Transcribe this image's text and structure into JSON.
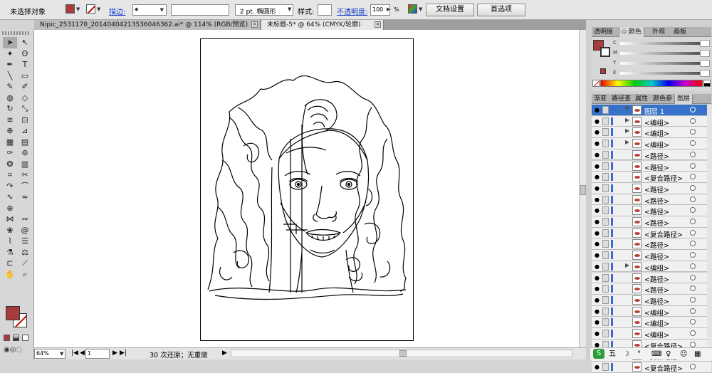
{
  "control_bar": {
    "selection_label": "未选择对象",
    "fill_color": "#a83b3b",
    "stroke_label": "描边:",
    "stroke_size": "",
    "brush_value": "",
    "brush_label": "2 pt. 椭圆形",
    "style_label": "样式:",
    "opacity_label": "不透明度:",
    "opacity_value": "100",
    "percent": "%",
    "doc_setup": "文档设置",
    "preferences": "首选项"
  },
  "tabs": [
    {
      "label": "Nipic_2531170_20140404213536046362.ai* @ 114% (RGB/预览)",
      "active": false
    },
    {
      "label": "未标题-5* @ 64% (CMYK/轮廓)",
      "active": true
    }
  ],
  "tools": [
    {
      "icon": "selection-tool-icon",
      "glyph": "➤"
    },
    {
      "icon": "direct-selection-tool-icon",
      "glyph": "↖"
    },
    {
      "icon": "magic-wand-icon",
      "glyph": "✦"
    },
    {
      "icon": "lasso-icon",
      "glyph": "ʘ"
    },
    {
      "icon": "pen-tool-icon",
      "glyph": "✒"
    },
    {
      "icon": "type-tool-icon",
      "glyph": "T"
    },
    {
      "icon": "line-tool-icon",
      "glyph": "╲"
    },
    {
      "icon": "rectangle-tool-icon",
      "glyph": "▭"
    },
    {
      "icon": "paintbrush-icon",
      "glyph": "✎"
    },
    {
      "icon": "pencil-icon",
      "glyph": "✐"
    },
    {
      "icon": "blob-brush-icon",
      "glyph": "◍"
    },
    {
      "icon": "eraser-icon",
      "glyph": "◇"
    },
    {
      "icon": "rotate-tool-icon",
      "glyph": "↻"
    },
    {
      "icon": "scale-tool-icon",
      "glyph": "⤡"
    },
    {
      "icon": "warp-tool-icon",
      "glyph": "≋"
    },
    {
      "icon": "free-transform-icon",
      "glyph": "⊡"
    },
    {
      "icon": "shape-builder-icon",
      "glyph": "⊕"
    },
    {
      "icon": "perspective-grid-icon",
      "glyph": "⊿"
    },
    {
      "icon": "mesh-tool-icon",
      "glyph": "▦"
    },
    {
      "icon": "gradient-tool-icon",
      "glyph": "▤"
    },
    {
      "icon": "eyedropper-icon",
      "glyph": "✑"
    },
    {
      "icon": "blend-tool-icon",
      "glyph": "⊚"
    },
    {
      "icon": "symbol-sprayer-icon",
      "glyph": "❂"
    },
    {
      "icon": "column-graph-icon",
      "glyph": "▥"
    },
    {
      "icon": "artboard-tool-icon",
      "glyph": "⌗"
    },
    {
      "icon": "slice-tool-icon",
      "glyph": "✂"
    },
    {
      "icon": "curve-red-icon",
      "glyph": "↷"
    },
    {
      "icon": "arc-red-icon",
      "glyph": "⌒"
    },
    {
      "icon": "wave-blue-icon",
      "glyph": "∿"
    },
    {
      "icon": "zigzag-icon",
      "glyph": "≈"
    },
    {
      "icon": "target-icon",
      "glyph": "⊕"
    },
    {
      "icon": "blank-icon",
      "glyph": ""
    },
    {
      "icon": "width-tool-icon",
      "glyph": "⋈"
    },
    {
      "icon": "wave-tool-icon",
      "glyph": "∾"
    },
    {
      "icon": "scallop-icon",
      "glyph": "❀"
    },
    {
      "icon": "twirl-icon",
      "glyph": "@"
    },
    {
      "icon": "wrinkle-icon",
      "glyph": "⌇"
    },
    {
      "icon": "align-icon",
      "glyph": "☰"
    },
    {
      "icon": "eyedropper2-icon",
      "glyph": "⚗"
    },
    {
      "icon": "measure-icon",
      "glyph": "⚖"
    },
    {
      "icon": "crop-icon",
      "glyph": "⊏"
    },
    {
      "icon": "knife-icon",
      "glyph": "⟋"
    },
    {
      "icon": "hand-tool-icon",
      "glyph": "✋"
    },
    {
      "icon": "zoom-tool-icon",
      "glyph": "⌕"
    }
  ],
  "status_bar": {
    "zoom": "64%",
    "page": "1",
    "undo_text": "30 次还原；无重做"
  },
  "color_panel": {
    "tabs": [
      "透明度",
      "颜色",
      "外观",
      "画板"
    ],
    "channels": [
      "C",
      "M",
      "Y",
      "K"
    ]
  },
  "layers_panel": {
    "tabs": [
      "渐变",
      "路径查",
      "属性",
      "颜色参",
      "图层"
    ],
    "items": [
      {
        "name": "图层 1",
        "top": true
      },
      {
        "name": "<编组>",
        "expand": true
      },
      {
        "name": "<编组>",
        "expand": true
      },
      {
        "name": "<编组>",
        "expand": true
      },
      {
        "name": "<路径>"
      },
      {
        "name": "<路径>"
      },
      {
        "name": "<复合路径>"
      },
      {
        "name": "<路径>"
      },
      {
        "name": "<路径>"
      },
      {
        "name": "<路径>"
      },
      {
        "name": "<路径>"
      },
      {
        "name": "<复合路径>"
      },
      {
        "name": "<路径>"
      },
      {
        "name": "<路径>"
      },
      {
        "name": "<编组>",
        "expand": true
      },
      {
        "name": "<路径>"
      },
      {
        "name": "<路径>"
      },
      {
        "name": "<路径>"
      },
      {
        "name": "<编组>"
      },
      {
        "name": "<编组>"
      },
      {
        "name": "<编组>"
      },
      {
        "name": "<复合路径>"
      },
      {
        "name": "<复合路径>"
      },
      {
        "name": "<复合路径>"
      }
    ]
  },
  "ime_bar": {
    "glyphs": [
      "五",
      "☽",
      "°",
      "⌨",
      "♀",
      "☺",
      "▦"
    ]
  }
}
